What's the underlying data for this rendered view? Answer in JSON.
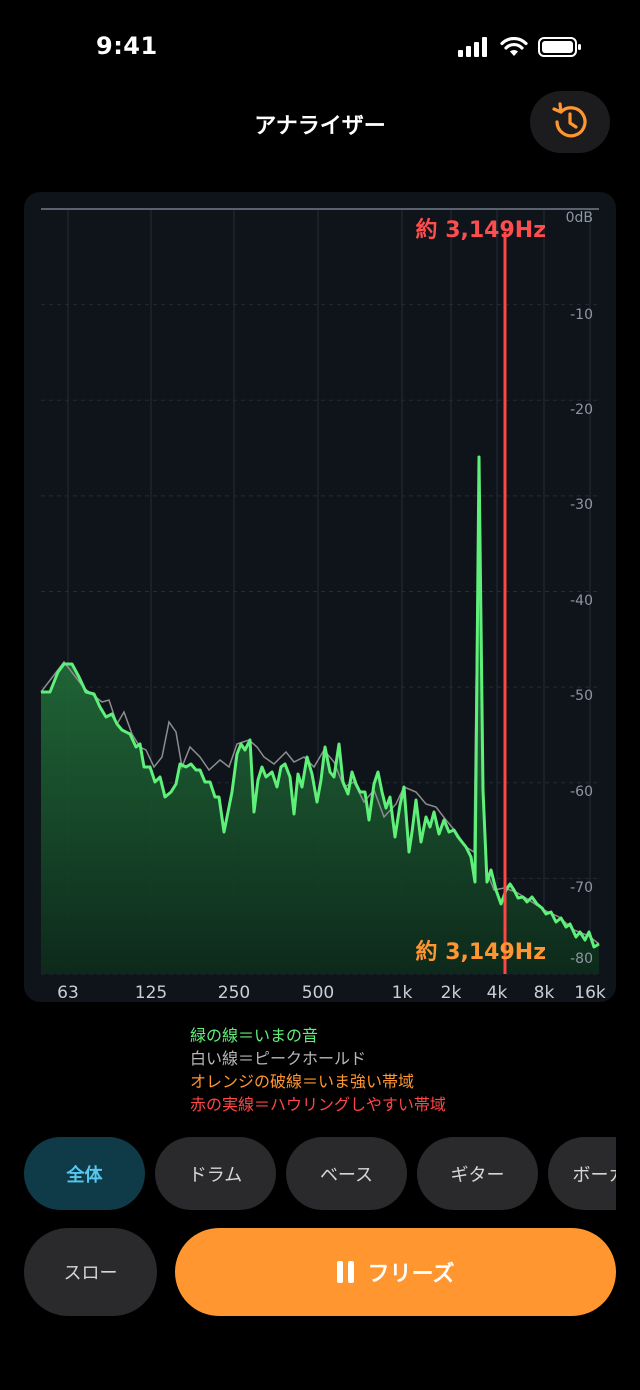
{
  "status_bar": {
    "time": "9:41"
  },
  "header": {
    "title": "アナライザー"
  },
  "analyzer": {
    "x_ticks": [
      "63",
      "125",
      "250",
      "500",
      "1k",
      "2k",
      "4k",
      "8k",
      "16k"
    ],
    "y_ticks": [
      "0dB",
      "-10",
      "-20",
      "-30",
      "-40",
      "-50",
      "-60",
      "-70",
      "-80"
    ],
    "peak_label_top": "約 3,149Hz",
    "peak_label_bottom": "約 3,149Hz",
    "peak_marker_x": 481,
    "colors": {
      "live": "#5ff07a",
      "peak_hold": "#8d8d8d",
      "howl": "#ff4545",
      "accent": "#ff9630"
    }
  },
  "legend": {
    "green": "緑の線＝いまの音",
    "white": "白い線＝ピークホールド",
    "orange": "オレンジの破線＝いま強い帯域",
    "red": "赤の実線＝ハウリングしやすい帯域"
  },
  "filters": [
    {
      "label": "全体",
      "active": true
    },
    {
      "label": "ドラム",
      "active": false
    },
    {
      "label": "ベース",
      "active": false
    },
    {
      "label": "ギター",
      "active": false
    },
    {
      "label": "ボーカル",
      "active": false
    }
  ],
  "controls": {
    "slow_label": "スロー",
    "freeze_label": "フリーズ"
  },
  "icons": {
    "history": "history-clock-icon",
    "pause": "pause-icon",
    "signal": "cellular-signal-icon",
    "wifi": "wifi-icon",
    "battery": "battery-icon"
  }
}
